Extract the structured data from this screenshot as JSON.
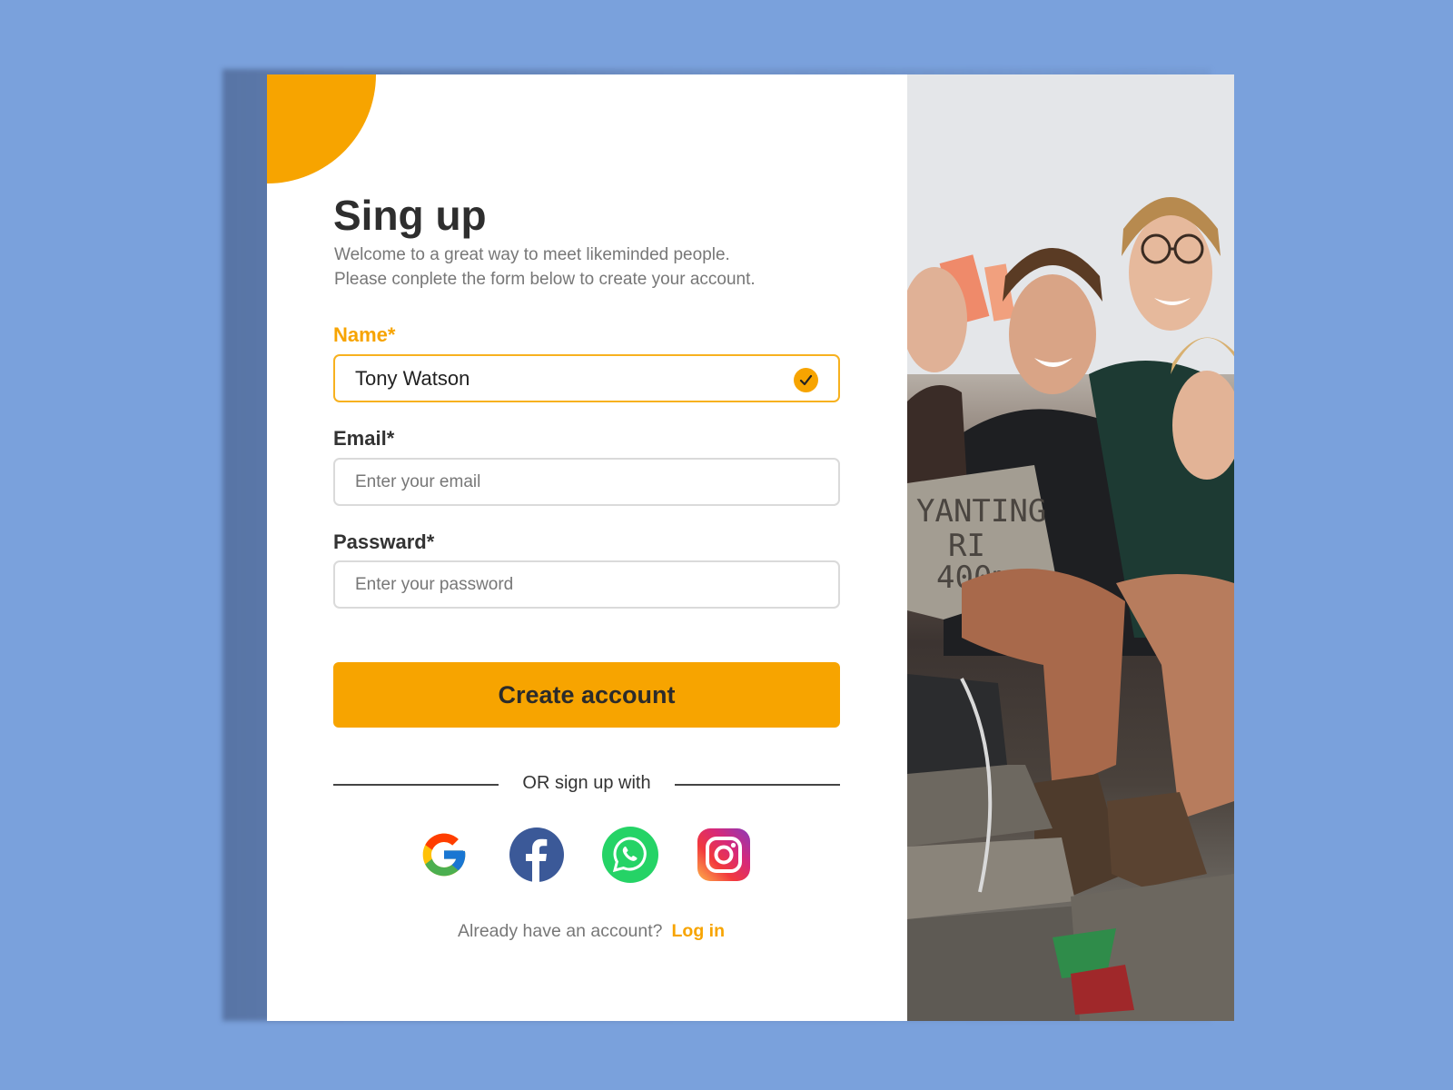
{
  "form": {
    "title": "Sing up",
    "subtitle_line1": "Welcome to a great way to meet likeminded people.",
    "subtitle_line2": "Please conplete the form below to create your account.",
    "name_label": "Name*",
    "name_value": "Tony Watson",
    "email_label": "Email*",
    "email_placeholder": "Enter your email",
    "password_label": "Passward*",
    "password_placeholder": "Enter your password",
    "submit_label": "Create account",
    "divider_text": "OR sign up with",
    "login_prompt": "Already have an account?",
    "login_link": "Log in"
  },
  "social": [
    "google-icon",
    "facebook-icon",
    "whatsapp-icon",
    "instagram-icon"
  ],
  "photo": {
    "sign_text_1": "YANTING",
    "sign_text_2": "RI",
    "sign_text_3": "400m"
  },
  "colors": {
    "background": "#7aa1dc",
    "accent": "#f7a400",
    "card": "#ffffff",
    "text_dark": "#2e2e2e",
    "text_muted": "#777777"
  }
}
